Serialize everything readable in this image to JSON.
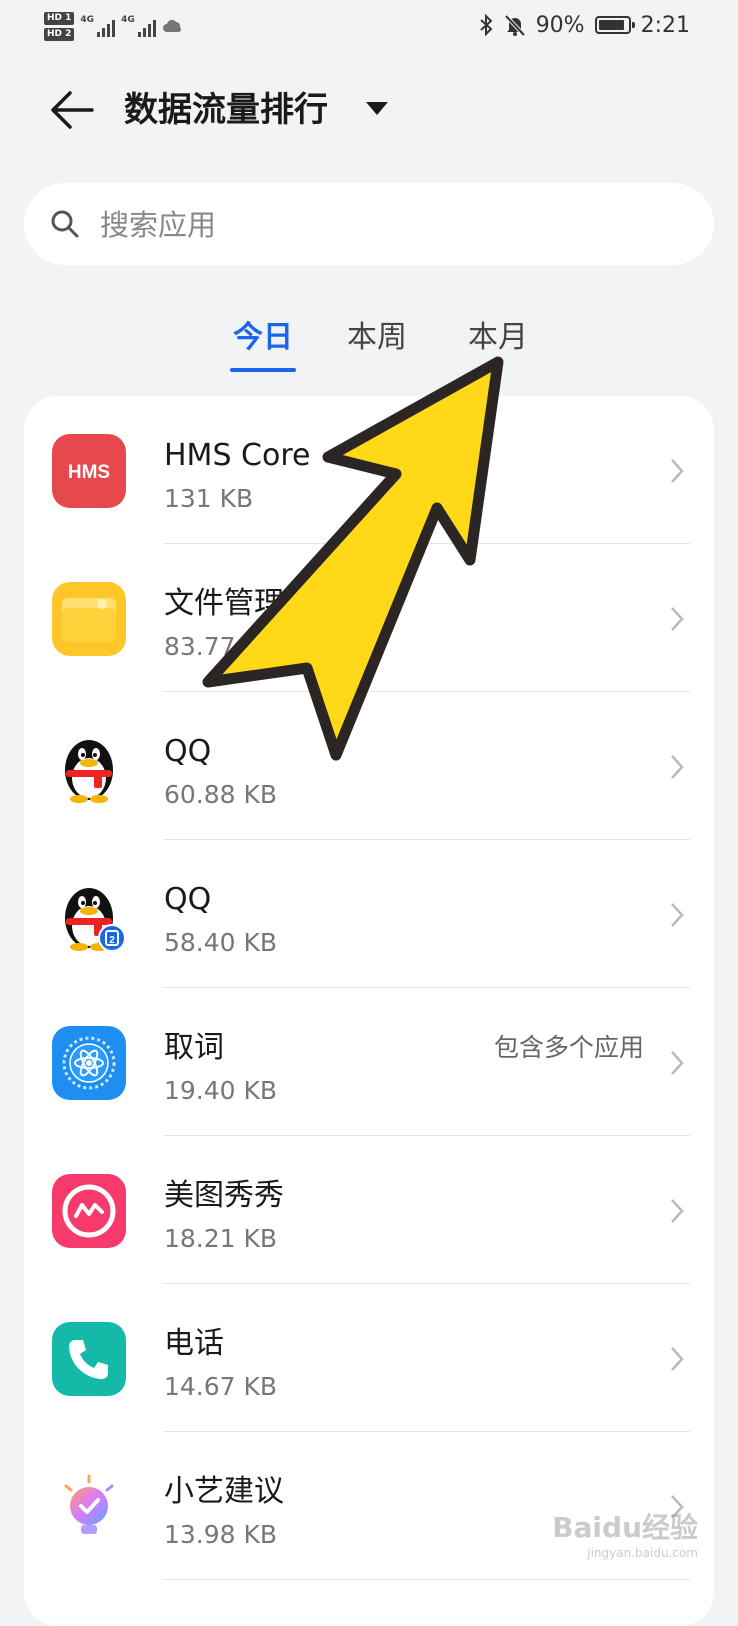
{
  "status_bar": {
    "hd1": "HD 1",
    "hd2": "HD 2",
    "net1": "4G",
    "net2": "4G",
    "battery_percent": "90%",
    "battery_level": 0.9,
    "time": "2:21"
  },
  "header": {
    "title": "数据流量排行"
  },
  "search": {
    "placeholder": "搜索应用"
  },
  "tabs": [
    {
      "label": "今日",
      "active": true
    },
    {
      "label": "本周",
      "active": false
    },
    {
      "label": "本月",
      "active": false
    }
  ],
  "apps": [
    {
      "name": "HMS Core",
      "size": "131 KB",
      "note": "",
      "icon": "hms-core-icon"
    },
    {
      "name": "文件管理",
      "size": "83.77 KB",
      "note": "",
      "icon": "file-manager-icon"
    },
    {
      "name": "QQ",
      "size": "60.88 KB",
      "note": "",
      "icon": "qq-icon"
    },
    {
      "name": "QQ",
      "size": "58.40 KB",
      "note": "",
      "icon": "qq-clone-icon"
    },
    {
      "name": "取词",
      "size": "19.40 KB",
      "note": "包含多个应用",
      "icon": "word-capture-icon"
    },
    {
      "name": "美图秀秀",
      "size": "18.21 KB",
      "note": "",
      "icon": "meitu-icon"
    },
    {
      "name": "电话",
      "size": "14.67 KB",
      "note": "",
      "icon": "phone-icon"
    },
    {
      "name": "小艺建议",
      "size": "13.98 KB",
      "note": "",
      "icon": "celia-suggestion-icon"
    }
  ],
  "watermark": {
    "text": "Baidu经验",
    "url": "jingyan.baidu.com"
  },
  "colors": {
    "accent": "#1a66e8",
    "background": "#f1f3f5",
    "arrow_fill": "#ffd817",
    "arrow_stroke": "#2b2523"
  }
}
